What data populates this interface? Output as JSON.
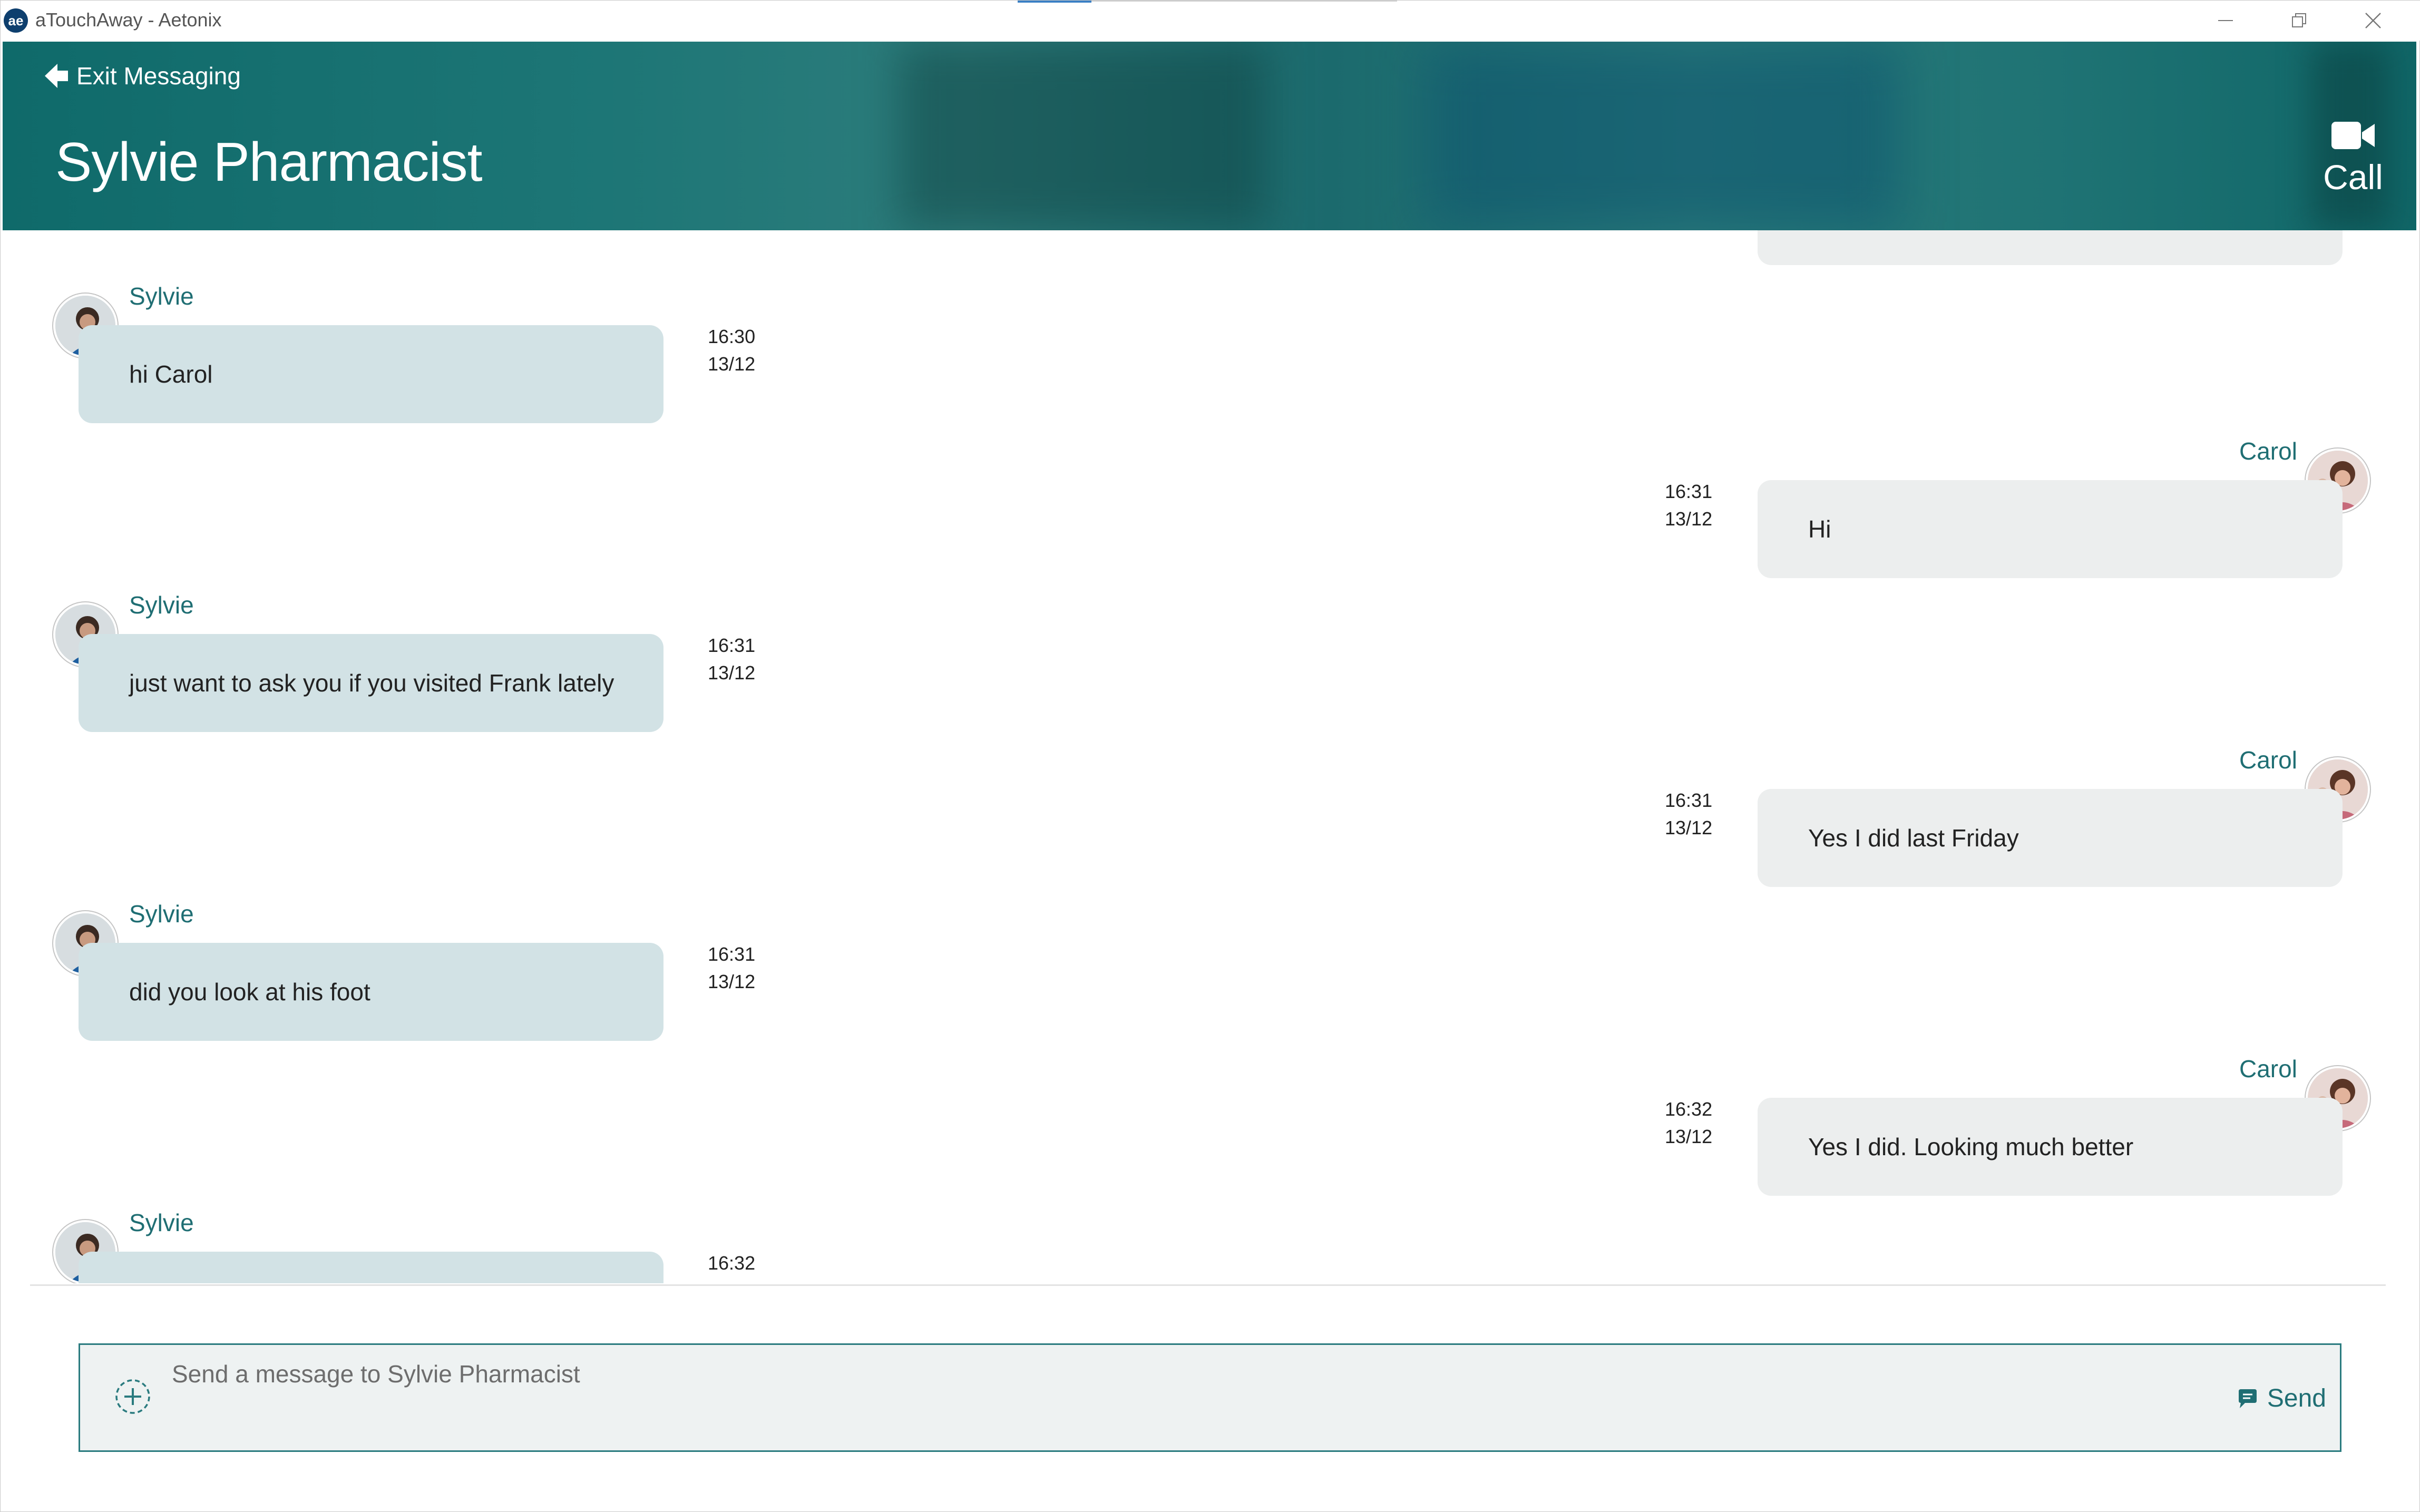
{
  "window": {
    "title": "aTouchAway - Aetonix",
    "logo_text": "ae"
  },
  "header": {
    "exit_label": "Exit Messaging",
    "contact_name": "Sylvie Pharmacist",
    "call_label": "Call"
  },
  "messages": [
    {
      "sender": "Sylvie",
      "text": "hi Carol",
      "time": "16:30",
      "date": "13/12",
      "direction": "in"
    },
    {
      "sender": "Carol",
      "text": "Hi",
      "time": "16:31",
      "date": "13/12",
      "direction": "out"
    },
    {
      "sender": "Sylvie",
      "text": "just want to ask you if you visited Frank lately",
      "time": "16:31",
      "date": "13/12",
      "direction": "in"
    },
    {
      "sender": "Carol",
      "text": "Yes I did last Friday",
      "time": "16:31",
      "date": "13/12",
      "direction": "out"
    },
    {
      "sender": "Sylvie",
      "text": "did you look at his foot",
      "time": "16:31",
      "date": "13/12",
      "direction": "in"
    },
    {
      "sender": "Carol",
      "text": "Yes I did. Looking much better",
      "time": "16:32",
      "date": "13/12",
      "direction": "out"
    },
    {
      "sender": "Sylvie",
      "text": "",
      "time": "16:32",
      "date": "",
      "direction": "in"
    }
  ],
  "composer": {
    "placeholder": "Send a message to Sylvie Pharmacist",
    "send_label": "Send"
  },
  "colors": {
    "header": "#1d7474",
    "accent": "#1f6e73",
    "incoming_bubble": "#d2e2e5",
    "outgoing_bubble": "#eceeee"
  },
  "icons": [
    "back-arrow-icon",
    "video-camera-icon",
    "add-attachment-icon",
    "chat-bubble-icon",
    "minimize-icon",
    "restore-icon",
    "close-icon"
  ]
}
